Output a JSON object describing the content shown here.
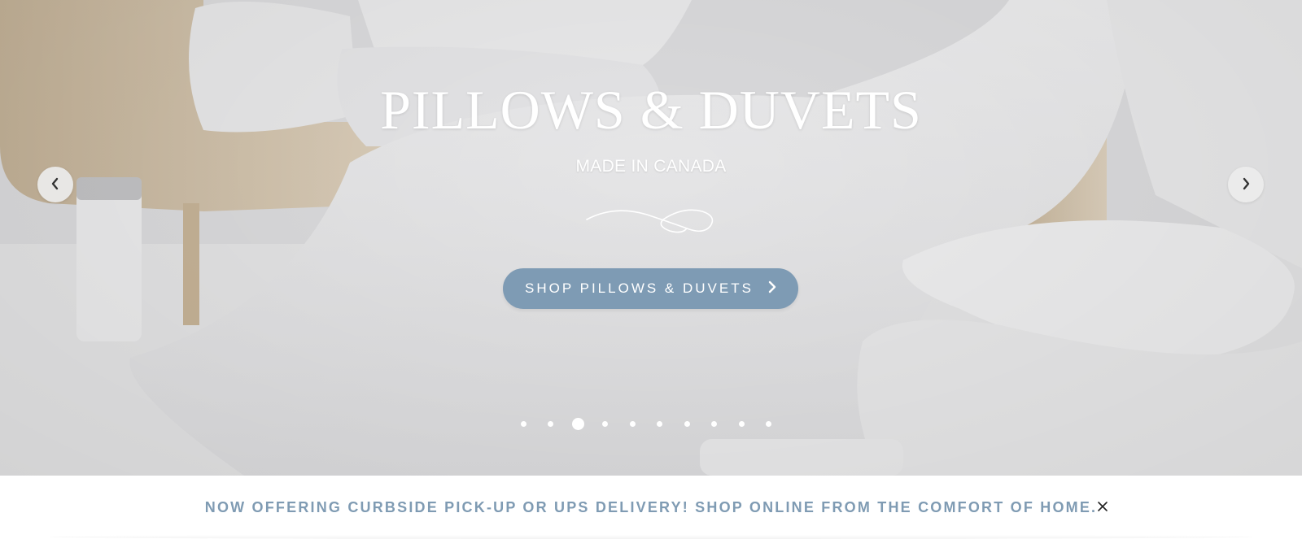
{
  "hero": {
    "title": "PILLOWS & DUVETS",
    "subtitle": "MADE IN CANADA",
    "cta_label": "SHOP PILLOWS & DUVETS",
    "prev_icon": "chevron-left-icon",
    "next_icon": "chevron-right-icon",
    "slide_count": 10,
    "active_slide": 3
  },
  "announcement": {
    "text": "NOW OFFERING CURBSIDE PICK-UP OR UPS DELIVERY! SHOP ONLINE FROM THE COMFORT OF HOME.",
    "close_icon": "close-icon"
  },
  "colors": {
    "cta_background": "#7e9bb4",
    "announcement_text": "#7f9bb3",
    "hero_text": "#ffffff"
  }
}
